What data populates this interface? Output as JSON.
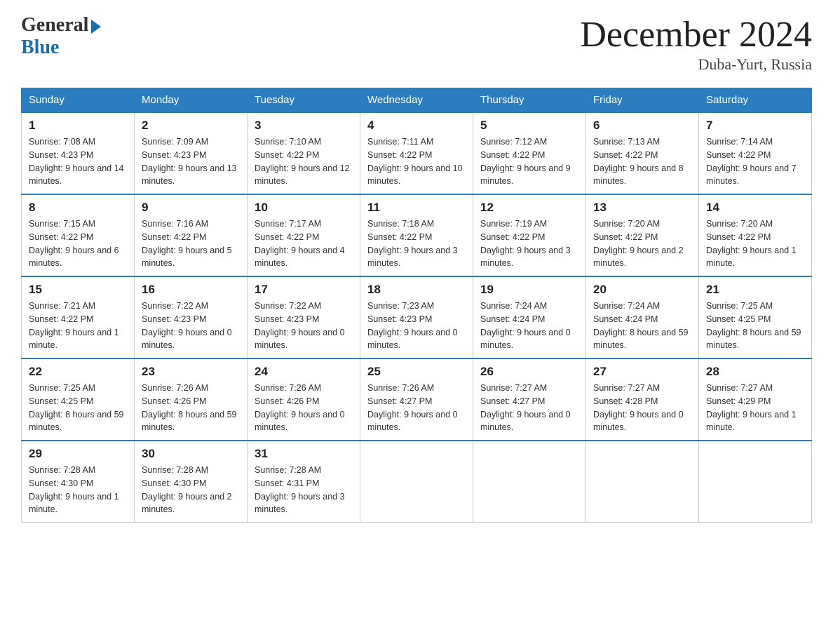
{
  "logo": {
    "general": "General",
    "blue": "Blue"
  },
  "title": "December 2024",
  "location": "Duba-Yurt, Russia",
  "days_of_week": [
    "Sunday",
    "Monday",
    "Tuesday",
    "Wednesday",
    "Thursday",
    "Friday",
    "Saturday"
  ],
  "weeks": [
    [
      {
        "day": "1",
        "sunrise": "7:08 AM",
        "sunset": "4:23 PM",
        "daylight": "9 hours and 14 minutes."
      },
      {
        "day": "2",
        "sunrise": "7:09 AM",
        "sunset": "4:23 PM",
        "daylight": "9 hours and 13 minutes."
      },
      {
        "day": "3",
        "sunrise": "7:10 AM",
        "sunset": "4:22 PM",
        "daylight": "9 hours and 12 minutes."
      },
      {
        "day": "4",
        "sunrise": "7:11 AM",
        "sunset": "4:22 PM",
        "daylight": "9 hours and 10 minutes."
      },
      {
        "day": "5",
        "sunrise": "7:12 AM",
        "sunset": "4:22 PM",
        "daylight": "9 hours and 9 minutes."
      },
      {
        "day": "6",
        "sunrise": "7:13 AM",
        "sunset": "4:22 PM",
        "daylight": "9 hours and 8 minutes."
      },
      {
        "day": "7",
        "sunrise": "7:14 AM",
        "sunset": "4:22 PM",
        "daylight": "9 hours and 7 minutes."
      }
    ],
    [
      {
        "day": "8",
        "sunrise": "7:15 AM",
        "sunset": "4:22 PM",
        "daylight": "9 hours and 6 minutes."
      },
      {
        "day": "9",
        "sunrise": "7:16 AM",
        "sunset": "4:22 PM",
        "daylight": "9 hours and 5 minutes."
      },
      {
        "day": "10",
        "sunrise": "7:17 AM",
        "sunset": "4:22 PM",
        "daylight": "9 hours and 4 minutes."
      },
      {
        "day": "11",
        "sunrise": "7:18 AM",
        "sunset": "4:22 PM",
        "daylight": "9 hours and 3 minutes."
      },
      {
        "day": "12",
        "sunrise": "7:19 AM",
        "sunset": "4:22 PM",
        "daylight": "9 hours and 3 minutes."
      },
      {
        "day": "13",
        "sunrise": "7:20 AM",
        "sunset": "4:22 PM",
        "daylight": "9 hours and 2 minutes."
      },
      {
        "day": "14",
        "sunrise": "7:20 AM",
        "sunset": "4:22 PM",
        "daylight": "9 hours and 1 minute."
      }
    ],
    [
      {
        "day": "15",
        "sunrise": "7:21 AM",
        "sunset": "4:22 PM",
        "daylight": "9 hours and 1 minute."
      },
      {
        "day": "16",
        "sunrise": "7:22 AM",
        "sunset": "4:23 PM",
        "daylight": "9 hours and 0 minutes."
      },
      {
        "day": "17",
        "sunrise": "7:22 AM",
        "sunset": "4:23 PM",
        "daylight": "9 hours and 0 minutes."
      },
      {
        "day": "18",
        "sunrise": "7:23 AM",
        "sunset": "4:23 PM",
        "daylight": "9 hours and 0 minutes."
      },
      {
        "day": "19",
        "sunrise": "7:24 AM",
        "sunset": "4:24 PM",
        "daylight": "9 hours and 0 minutes."
      },
      {
        "day": "20",
        "sunrise": "7:24 AM",
        "sunset": "4:24 PM",
        "daylight": "8 hours and 59 minutes."
      },
      {
        "day": "21",
        "sunrise": "7:25 AM",
        "sunset": "4:25 PM",
        "daylight": "8 hours and 59 minutes."
      }
    ],
    [
      {
        "day": "22",
        "sunrise": "7:25 AM",
        "sunset": "4:25 PM",
        "daylight": "8 hours and 59 minutes."
      },
      {
        "day": "23",
        "sunrise": "7:26 AM",
        "sunset": "4:26 PM",
        "daylight": "8 hours and 59 minutes."
      },
      {
        "day": "24",
        "sunrise": "7:26 AM",
        "sunset": "4:26 PM",
        "daylight": "9 hours and 0 minutes."
      },
      {
        "day": "25",
        "sunrise": "7:26 AM",
        "sunset": "4:27 PM",
        "daylight": "9 hours and 0 minutes."
      },
      {
        "day": "26",
        "sunrise": "7:27 AM",
        "sunset": "4:27 PM",
        "daylight": "9 hours and 0 minutes."
      },
      {
        "day": "27",
        "sunrise": "7:27 AM",
        "sunset": "4:28 PM",
        "daylight": "9 hours and 0 minutes."
      },
      {
        "day": "28",
        "sunrise": "7:27 AM",
        "sunset": "4:29 PM",
        "daylight": "9 hours and 1 minute."
      }
    ],
    [
      {
        "day": "29",
        "sunrise": "7:28 AM",
        "sunset": "4:30 PM",
        "daylight": "9 hours and 1 minute."
      },
      {
        "day": "30",
        "sunrise": "7:28 AM",
        "sunset": "4:30 PM",
        "daylight": "9 hours and 2 minutes."
      },
      {
        "day": "31",
        "sunrise": "7:28 AM",
        "sunset": "4:31 PM",
        "daylight": "9 hours and 3 minutes."
      },
      null,
      null,
      null,
      null
    ]
  ]
}
